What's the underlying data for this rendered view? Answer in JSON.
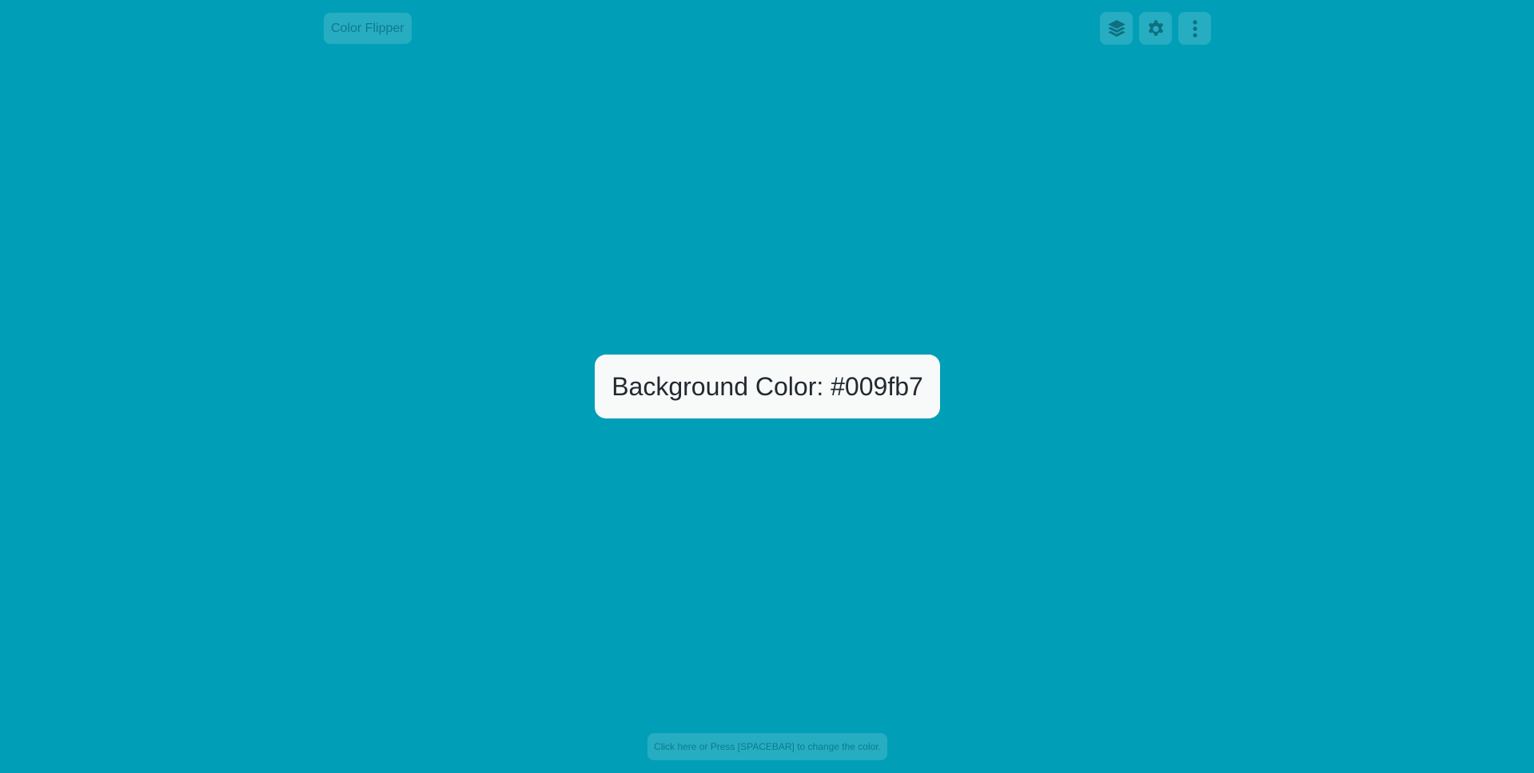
{
  "header": {
    "brand_label": "Color Flipper"
  },
  "toolbar": {
    "buttons": [
      {
        "icon": "layers-icon"
      },
      {
        "icon": "gear-icon"
      },
      {
        "icon": "more-vertical-icon"
      }
    ]
  },
  "main": {
    "color_label": "Background Color:",
    "color_value": "#009fb7"
  },
  "footer": {
    "hint": "Click here or Press [SPACEBAR] to change the color."
  },
  "colors": {
    "background": "#009fb7",
    "card": "#f8f9f9",
    "muted_text": "#0f7a8c"
  }
}
